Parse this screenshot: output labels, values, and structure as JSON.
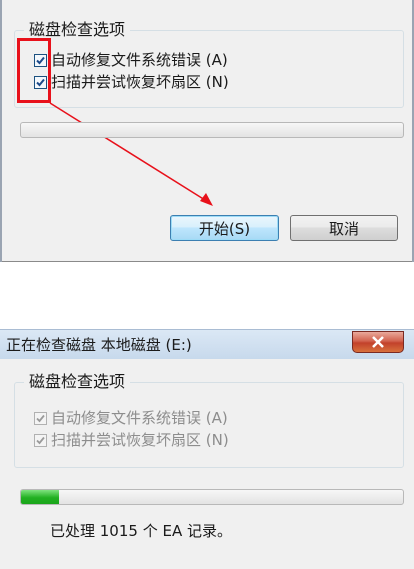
{
  "top_dialog": {
    "group_title": "磁盘检查选项",
    "options": [
      {
        "label": "自动修复文件系统错误 (A)",
        "checked": true
      },
      {
        "label": "扫描并尝试恢复坏扇区 (N)",
        "checked": true
      }
    ],
    "progress": 0,
    "buttons": {
      "start": "开始(S)",
      "cancel": "取消"
    },
    "annotation_color": "#e8111b"
  },
  "bottom_dialog": {
    "title": "正在检查磁盘 本地磁盘 (E:)",
    "close_icon": "close-icon",
    "group_title": "磁盘检查选项",
    "options": [
      {
        "label": "自动修复文件系统错误 (A)",
        "checked": true,
        "enabled": false
      },
      {
        "label": "扫描并尝试恢复坏扇区 (N)",
        "checked": true,
        "enabled": false
      }
    ],
    "progress": 0.1,
    "status": "已处理 1015 个 EA 记录。",
    "accent": "#22b022"
  }
}
